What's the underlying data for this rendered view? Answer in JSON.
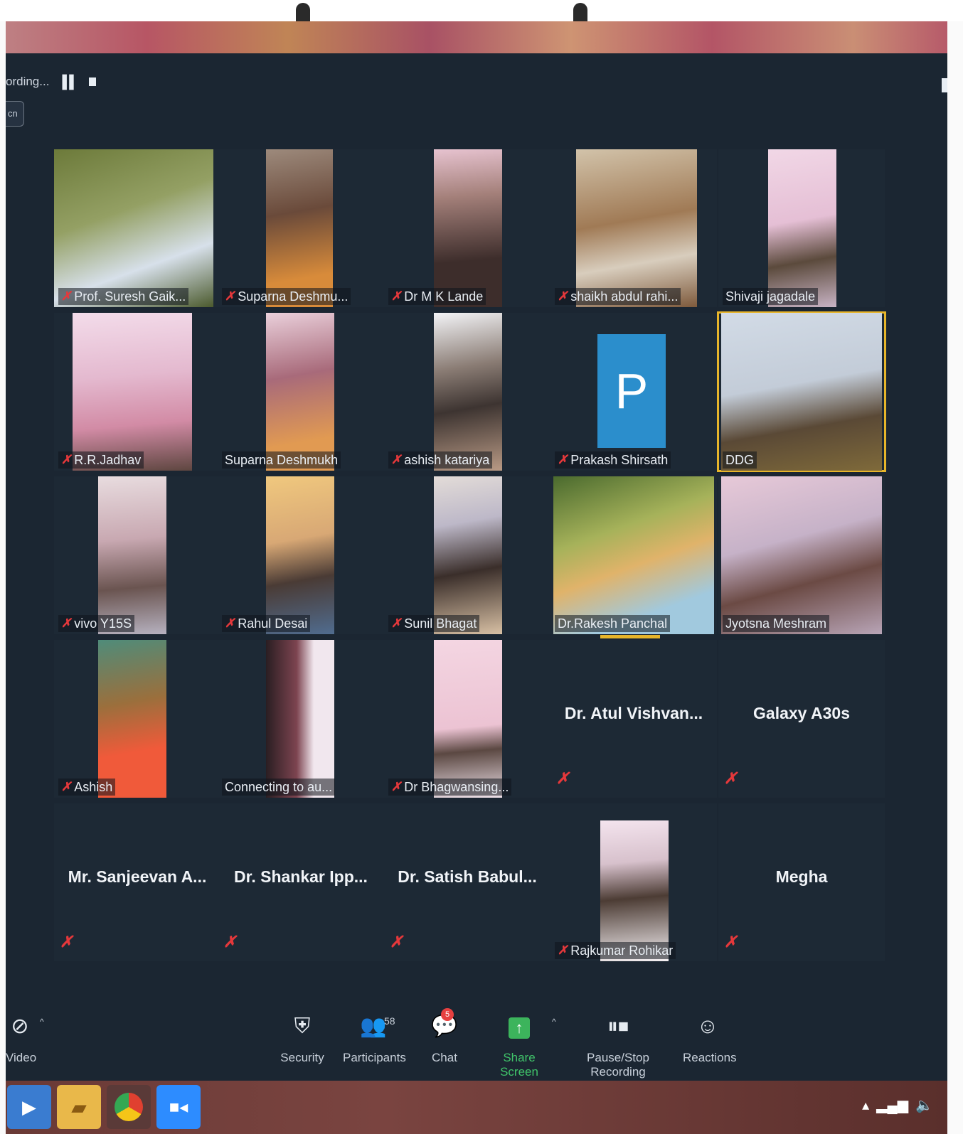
{
  "meeting": {
    "recording_label": "ording...",
    "view_button_label": "cn"
  },
  "gallery": [
    {
      "name": "Prof. Suresh Gaik...",
      "muted": true
    },
    {
      "name": "Suparna Deshmu...",
      "muted": true
    },
    {
      "name": "Dr M K Lande",
      "muted": true
    },
    {
      "name": "shaikh abdul rahi...",
      "muted": true
    },
    {
      "name": "Shivaji jagadale",
      "muted": false
    },
    {
      "name": "R.R.Jadhav",
      "muted": true
    },
    {
      "name": "Suparna Deshmukh",
      "muted": false
    },
    {
      "name": "ashish katariya",
      "muted": true
    },
    {
      "name": "Prakash Shirsath",
      "initial": "P",
      "muted": true
    },
    {
      "name": "DDG",
      "muted": false,
      "active_speaker": true
    },
    {
      "name": "vivo Y15S",
      "muted": true
    },
    {
      "name": "Rahul Desai",
      "muted": true
    },
    {
      "name": "Sunil Bhagat",
      "muted": true
    },
    {
      "name": "Dr.Rakesh Panchal",
      "muted": false
    },
    {
      "name": "Jyotsna Meshram",
      "muted": false
    },
    {
      "name": "Ashish",
      "muted": true
    },
    {
      "name": "Connecting to au... ",
      "muted": false
    },
    {
      "name": "Dr Bhagwansing...",
      "muted": true
    },
    {
      "name": "Dr. Atul Vishvan...",
      "muted": true
    },
    {
      "name": "Galaxy A30s",
      "muted": true
    },
    {
      "name": "Mr. Sanjeevan A...",
      "muted": true
    },
    {
      "name": "Dr. Shankar Ipp...",
      "muted": true
    },
    {
      "name": "Dr. Satish Babul...",
      "muted": true
    },
    {
      "name": "Rajkumar Rohikar",
      "muted": true
    },
    {
      "name": "Megha",
      "muted": true
    }
  ],
  "toolbar": {
    "video_label": "Video",
    "security_label": "Security",
    "participants_label": "Participants",
    "participant_count": "58",
    "chat_label": "Chat",
    "chat_badge": "5",
    "share_label": "Share Screen",
    "recording_label": "Pause/Stop Recording",
    "reactions_label": "Reactions"
  },
  "colors": {
    "meeting_background": "#1b2632",
    "active_speaker_border": "#e7b52a",
    "muted_mic": "#e5383b",
    "share_screen": "#3cb45c",
    "avatar_tile": "#2b8ecc"
  }
}
